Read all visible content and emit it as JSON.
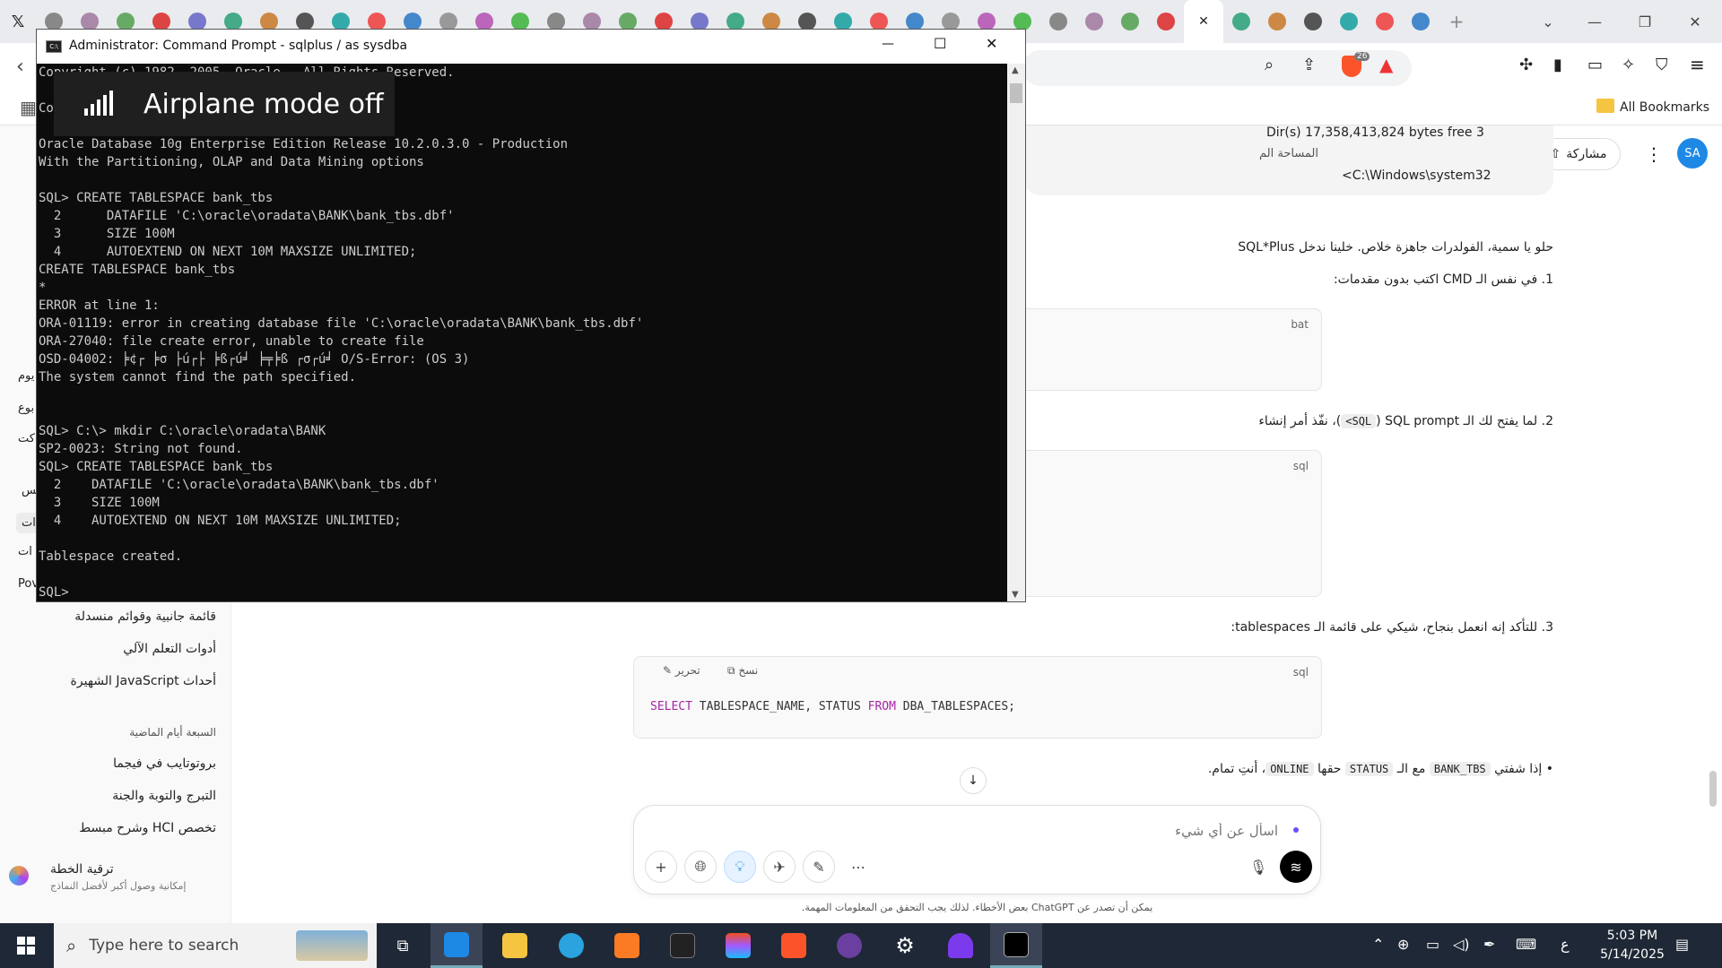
{
  "browser": {
    "tab_icon_count": 40,
    "active_tab_close": "✕",
    "new_tab": "+",
    "tab_search": "⌄",
    "win_minimize": "—",
    "win_restore": "❐",
    "win_close": "✕",
    "shield_badge": "26",
    "bookmarks_label": "All Bookmarks"
  },
  "cmd": {
    "title": "Administrator: Command Prompt - sqlplus  / as sysdba",
    "lines": [
      "Copyright (c) 1982, 2005, Oracle.  All Rights Reserved.",
      "",
      "Connected to:",
      "",
      "Oracle Database 10g Enterprise Edition Release 10.2.0.3.0 - Production",
      "With the Partitioning, OLAP and Data Mining options",
      "",
      "SQL> CREATE TABLESPACE bank_tbs",
      "  2      DATAFILE 'C:\\oracle\\oradata\\BANK\\bank_tbs.dbf'",
      "  3      SIZE 100M",
      "  4      AUTOEXTEND ON NEXT 10M MAXSIZE UNLIMITED;",
      "CREATE TABLESPACE bank_tbs",
      "*",
      "ERROR at line 1:",
      "ORA-01119: error in creating database file 'C:\\oracle\\oradata\\BANK\\bank_tbs.dbf'",
      "ORA-27040: file create error, unable to create file",
      "OSD-04002: ╞¢┌ ╞σ ├ú┌├ ╞ß┌ú╛ ╞╤╞ß ┌σ┌ú╛ O/S-Error: (OS 3)",
      "The system cannot find the path specified.",
      "",
      "",
      "SQL> C:\\> mkdir C:\\oracle\\oradata\\BANK",
      "SP2-0023: String not found.",
      "SQL> CREATE TABLESPACE bank_tbs",
      "  2    DATAFILE 'C:\\oracle\\oradata\\BANK\\bank_tbs.dbf'",
      "  3    SIZE 100M",
      "  4    AUTOEXTEND ON NEXT 10M MAXSIZE UNLIMITED;",
      "",
      "Tablespace created.",
      "",
      "SQL> "
    ],
    "minimize": "—",
    "maximize": "☐",
    "close": "✕"
  },
  "toast": {
    "text": "Airplane mode off"
  },
  "sidebar": {
    "items": [
      {
        "label": "قائمة جانبية وقوائم منسدلة",
        "top": 0
      },
      {
        "label": "أدوات التعلم الآلي"
      },
      {
        "label": "أحداث JavaScript الشهيرة"
      }
    ],
    "heading": "السبعة أيام الماضية",
    "recent": [
      {
        "label": "بروتوتايب في فيجما"
      },
      {
        "label": "التبرج والتوبة والجنة"
      },
      {
        "label": "تخصص HCI وشرح مبسط"
      }
    ],
    "partial_items": [
      "سس",
      "ات",
      "ات",
      "Pov",
      "يوم",
      "بوع",
      "كت"
    ],
    "upgrade_title": "ترقية الخطة",
    "upgrade_sub": "إمكانية وصول أكبر لأفضل النماذج"
  },
  "chat": {
    "share_label": "مشاركة",
    "avatar": "SA",
    "dir_line": "Dir(s)  17,358,413,824 bytes free 3",
    "dir_sub": "المساحة الم",
    "path_line": "C:\\Windows\\system32>",
    "intro": "حلو يا سمية، الفولدرات جاهزة خلاص. خلينا ندخل SQL*Plus",
    "step1": "في نفس الـ CMD اكتب بدون مقدمات:",
    "step1_lang": "bat",
    "step2_pre": "لما يفتح لك الـ SQL prompt (",
    "step2_code": "SQL>",
    "step2_post": ")، نفّذ أمر إنشاء",
    "step2_lang": "sql",
    "step3": "للتأكد إنه انعمل بنجاح، شيكي على قائمة الـ tablespaces:",
    "step3_lang": "sql",
    "copy_label": "نسخ",
    "edit_label": "تحرير",
    "sql_kw1": "SELECT",
    "sql_mid": " TABLESPACE_NAME, STATUS ",
    "sql_kw2": "FROM",
    "sql_end": " DBA_TABLESPACES;",
    "bullet_pre": "إذا شفتي",
    "bullet_code1": "BANK_TBS",
    "bullet_mid": "مع الـ",
    "bullet_code2": "STATUS",
    "bullet_mid2": "حقها",
    "bullet_code3": "ONLINE",
    "bullet_end": "، أنتِ تمام.",
    "composer_placeholder": "اسأل عن أي شيء",
    "disclaimer": "يمكن أن تصدر عن ChatGPT بعض الأخطاء. لذلك يجب التحقق من المعلومات المهمة."
  },
  "taskbar": {
    "search_placeholder": "Type here to search",
    "time": "5:03 PM",
    "date": "5/14/2025",
    "lang": "ع"
  },
  "colors": {
    "accent_blue": "#1e88e5",
    "sql_keyword": "#a626a4",
    "taskbar": "#1f2836"
  }
}
